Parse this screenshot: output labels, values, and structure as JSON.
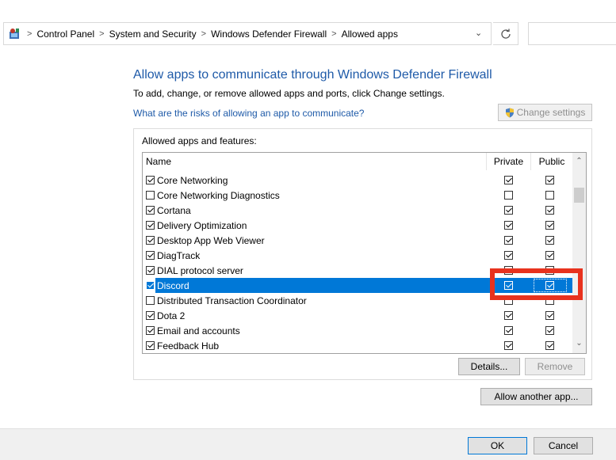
{
  "breadcrumb": {
    "items": [
      "Control Panel",
      "System and Security",
      "Windows Defender Firewall",
      "Allowed apps"
    ],
    "separator": ">"
  },
  "header": {
    "title": "Allow apps to communicate through Windows Defender Firewall",
    "subtitle": "To add, change, or remove allowed apps and ports, click Change settings.",
    "risks_link": "What are the risks of allowing an app to communicate?",
    "change_settings_label": "Change settings"
  },
  "group": {
    "label": "Allowed apps and features:",
    "columns": {
      "name": "Name",
      "private": "Private",
      "public": "Public"
    },
    "rows": [
      {
        "name": "Core Networking",
        "enabled": true,
        "private": true,
        "public": true
      },
      {
        "name": "Core Networking Diagnostics",
        "enabled": false,
        "private": false,
        "public": false
      },
      {
        "name": "Cortana",
        "enabled": true,
        "private": true,
        "public": true
      },
      {
        "name": "Delivery Optimization",
        "enabled": true,
        "private": true,
        "public": true
      },
      {
        "name": "Desktop App Web Viewer",
        "enabled": true,
        "private": true,
        "public": true
      },
      {
        "name": "DiagTrack",
        "enabled": true,
        "private": true,
        "public": true
      },
      {
        "name": "DIAL protocol server",
        "enabled": true,
        "private": true,
        "public": false
      },
      {
        "name": "Discord",
        "enabled": true,
        "private": true,
        "public": true,
        "selected": true
      },
      {
        "name": "Distributed Transaction Coordinator",
        "enabled": false,
        "private": false,
        "public": false
      },
      {
        "name": "Dota 2",
        "enabled": true,
        "private": true,
        "public": true
      },
      {
        "name": "Email and accounts",
        "enabled": true,
        "private": true,
        "public": true
      },
      {
        "name": "Feedback Hub",
        "enabled": true,
        "private": true,
        "public": true
      }
    ],
    "details_label": "Details...",
    "remove_label": "Remove"
  },
  "allow_another_label": "Allow another app...",
  "footer": {
    "ok_label": "OK",
    "cancel_label": "Cancel"
  },
  "colors": {
    "link": "#1e5aa8",
    "selection": "#0078d7",
    "highlight": "#e8321e"
  }
}
